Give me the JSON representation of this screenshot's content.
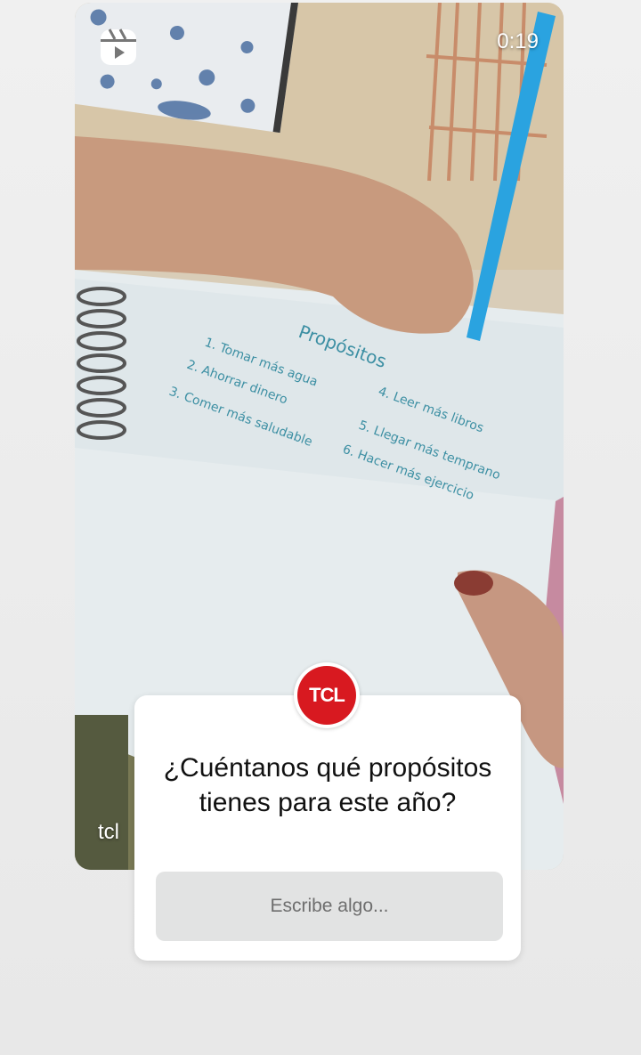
{
  "video": {
    "duration": "0:19",
    "author_visible": "tcl",
    "icon": "reels-icon",
    "notebook_text": {
      "heading": "Propósitos",
      "items": [
        "1. Tomar más agua",
        "2. Ahorrar dinero",
        "3. Comer más saludable",
        "4. Leer más libros",
        "5. Llegar más temprano",
        "6. Hacer más ejercicio"
      ]
    }
  },
  "question_sticker": {
    "avatar_text": "TCL",
    "brand_color": "#d81920",
    "question": "¿Cuéntanos qué propósitos tienes para este año?",
    "placeholder": "Escribe algo..."
  }
}
